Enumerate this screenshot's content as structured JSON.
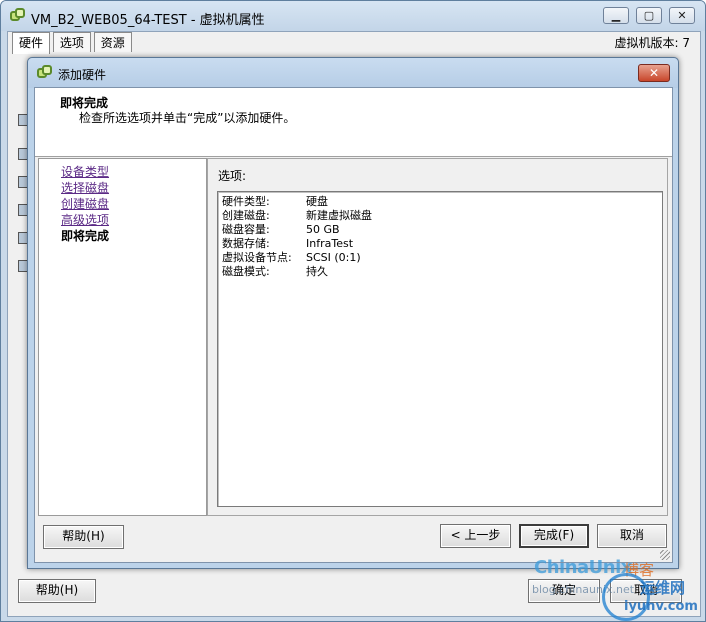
{
  "outer_window": {
    "title": "VM_B2_WEB05_64-TEST - 虚拟机属性",
    "tabs": [
      "硬件",
      "选项",
      "资源"
    ],
    "active_tab": 0,
    "vm_version": "虚拟机版本: 7",
    "buttons": {
      "help": "帮助(H)",
      "ok": "确定",
      "cancel": "取消"
    }
  },
  "dialog": {
    "title": "添加硬件",
    "header": {
      "title": "即将完成",
      "subtitle": "检查所选选项并单击“完成”以添加硬件。"
    },
    "nav": [
      {
        "label": "设备类型",
        "current": false
      },
      {
        "label": "选择磁盘",
        "current": false
      },
      {
        "label": "创建磁盘",
        "current": false
      },
      {
        "label": "高级选项",
        "current": false
      },
      {
        "label": "即将完成",
        "current": true
      }
    ],
    "options_label": "选项:",
    "summary": [
      {
        "key": "硬件类型:",
        "value": "硬盘"
      },
      {
        "key": "创建磁盘:",
        "value": "新建虚拟磁盘"
      },
      {
        "key": "磁盘容量:",
        "value": "50 GB"
      },
      {
        "key": "数据存储:",
        "value": "InfraTest"
      },
      {
        "key": "虚拟设备节点:",
        "value": "SCSI (0:1)"
      },
      {
        "key": "磁盘模式:",
        "value": "持久"
      }
    ],
    "buttons": {
      "help": "帮助(H)",
      "back": "< 上一步",
      "finish": "完成(F)",
      "cancel": "取消"
    }
  },
  "watermark": {
    "brand": "ChinaUnix",
    "blog": "博客",
    "url": "blog.chinaunix.net",
    "site": "运维网",
    "domain": "iyunv.com"
  },
  "colors": {
    "titlebar": "#c9dcf0",
    "link": "#5b2a86",
    "close_button": "#c8462b"
  }
}
